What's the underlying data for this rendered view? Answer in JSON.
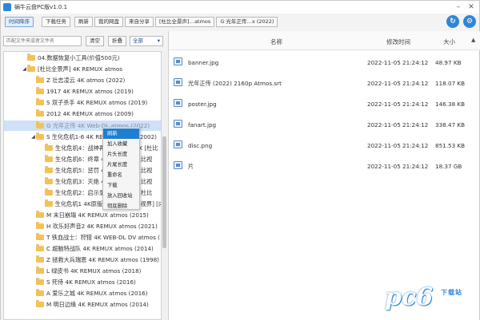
{
  "window": {
    "title": "蜗牛云盘PC版v1.0.1"
  },
  "toolbar": {
    "sort_label": "时间降序",
    "download_label": "下载任务",
    "refresh_label": "刷新",
    "breadcrumbs": [
      "我的网盘",
      "来自分享",
      "[杜比全景声]…atmos",
      "G 光年正传…x (2022)"
    ]
  },
  "search": {
    "placeholder": "匹配文件夹或者文件名",
    "clear_label": "清空",
    "collapse_label": "折叠",
    "filter_value": "全部"
  },
  "tree": {
    "items": [
      {
        "label": "04.数据恢复小工具(价值500元)",
        "arrow": ""
      },
      {
        "label": "[杜比全景声] 4K REMUX atmos",
        "arrow": "◢"
      },
      {
        "label": "Z 壮志凌云 4K atmos (2022)",
        "arrow": ""
      },
      {
        "label": "1917 4K REMUX atmos (2019)",
        "arrow": ""
      },
      {
        "label": "S 双子杀手 4K REMUX atmos (2019)",
        "arrow": ""
      },
      {
        "label": "2012 4K REMUX atmos (2009)",
        "arrow": ""
      },
      {
        "label": "G 光年正传 4K Web-DL atmos (2022)",
        "arrow": ""
      },
      {
        "label": "S 生化危机1-6 4K REMUX atmos (2002)",
        "arrow": "◢"
      },
      {
        "label": "生化危机4：战神再生 4K REMUX [杜比",
        "arrow": ""
      },
      {
        "label": "生化危机6：终章 4K REMUX [杜比视",
        "arrow": ""
      },
      {
        "label": "生化危机5：惩罚 4K REMUX [杜比视",
        "arrow": ""
      },
      {
        "label": "生化危机3：灭绝 4K REMUX [杜比视",
        "arrow": ""
      },
      {
        "label": "生化危机2：启示录 4K REMUX [杜比",
        "arrow": ""
      },
      {
        "label": "生化危机1 4K原版 REMUX [杜比视界] [内",
        "arrow": ""
      },
      {
        "label": "M 末日崩塌 4K REMUX atmos (2015)",
        "arrow": ""
      },
      {
        "label": "H 欢乐好声音2 4K REMUX atmos (2021)",
        "arrow": ""
      },
      {
        "label": "T 铁血战士：狩猎 4K WEB-DL DV atmos (",
        "arrow": ""
      },
      {
        "label": "C 超脑特战队 4K REMUX atmos (2014)",
        "arrow": ""
      },
      {
        "label": "Z 拯救大兵瑞恩 4K REMUX atmos (1998)",
        "arrow": ""
      },
      {
        "label": "L 绿皮书 4K REMUX atmos (2018)",
        "arrow": ""
      },
      {
        "label": "S 死侍 4K REMUX atmos (2016)",
        "arrow": ""
      },
      {
        "label": "A 爱乐之城 4K REMUX atmos (2016)",
        "arrow": ""
      },
      {
        "label": "M 明日边缘 4K REMUX atmos (2014)",
        "arrow": ""
      }
    ]
  },
  "context_menu": {
    "items": [
      "刷新",
      "加入收藏",
      "片头长度",
      "片尾长度",
      "重命名",
      "下载",
      "放入回收站",
      "彻底删除"
    ]
  },
  "list": {
    "headers": {
      "name": "名称",
      "modified": "修改时间",
      "size": "大小"
    },
    "sort_arrow": "▲",
    "rows": [
      {
        "name": "banner.jpg",
        "modified": "2022-11-05 21:24:12",
        "size": "48.97 KB"
      },
      {
        "name": "光年正传 (2022) 2160p Atmos.srt",
        "modified": "2022-11-05 21:24:12",
        "size": "118.07 KB"
      },
      {
        "name": "poster.jpg",
        "modified": "2022-11-05 21:24:12",
        "size": "146.38 KB"
      },
      {
        "name": "fanart.jpg",
        "modified": "2022-11-05 21:24:12",
        "size": "338.47 KB"
      },
      {
        "name": "disc.png",
        "modified": "2022-11-05 21:24:12",
        "size": "851.53 KB"
      },
      {
        "name": "片",
        "modified": "2022-11-05 21:24:12",
        "size": "18.37 GB"
      }
    ]
  },
  "watermark": {
    "logo_text": "pc6",
    "sub_text": "下载站"
  },
  "colors": {
    "accent": "#2f86d6",
    "selection": "#cfe1f6",
    "menu_highlight": "#1f7fd0",
    "folder": "#f2c25a"
  },
  "icons": {
    "refresh": "refresh-icon",
    "settings": "gear-icon",
    "minimize": "minimize-icon",
    "close": "close-icon"
  }
}
